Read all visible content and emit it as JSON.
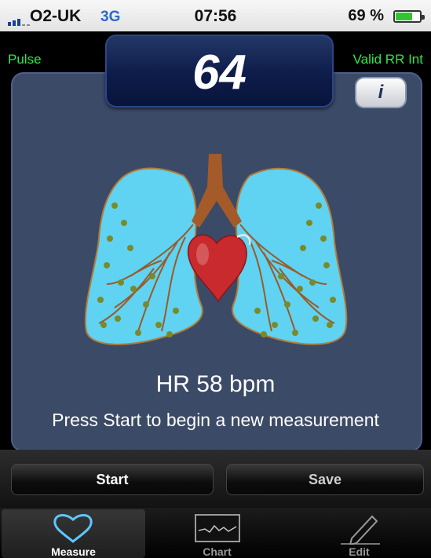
{
  "status_bar": {
    "carrier": "O2-UK",
    "network": "3G",
    "time": "07:56",
    "battery": "69 %",
    "battery_level": 0.69
  },
  "header": {
    "pulse_label": "Pulse",
    "pulse_value": "64",
    "rr_label": "Valid RR Int",
    "info_label": "i"
  },
  "main": {
    "hr_text": "HR 58 bpm",
    "instruction": "Press Start to begin a new measurement"
  },
  "buttons": {
    "start": "Start",
    "save": "Save"
  },
  "tabs": [
    {
      "label": "Measure",
      "icon": "heart-icon",
      "active": true
    },
    {
      "label": "Chart",
      "icon": "chart-icon",
      "active": false
    },
    {
      "label": "Edit",
      "icon": "pencil-icon",
      "active": false
    }
  ],
  "colors": {
    "accent_green": "#2ee64a",
    "panel": "#3b4a66",
    "display": "#0d1c4a"
  }
}
